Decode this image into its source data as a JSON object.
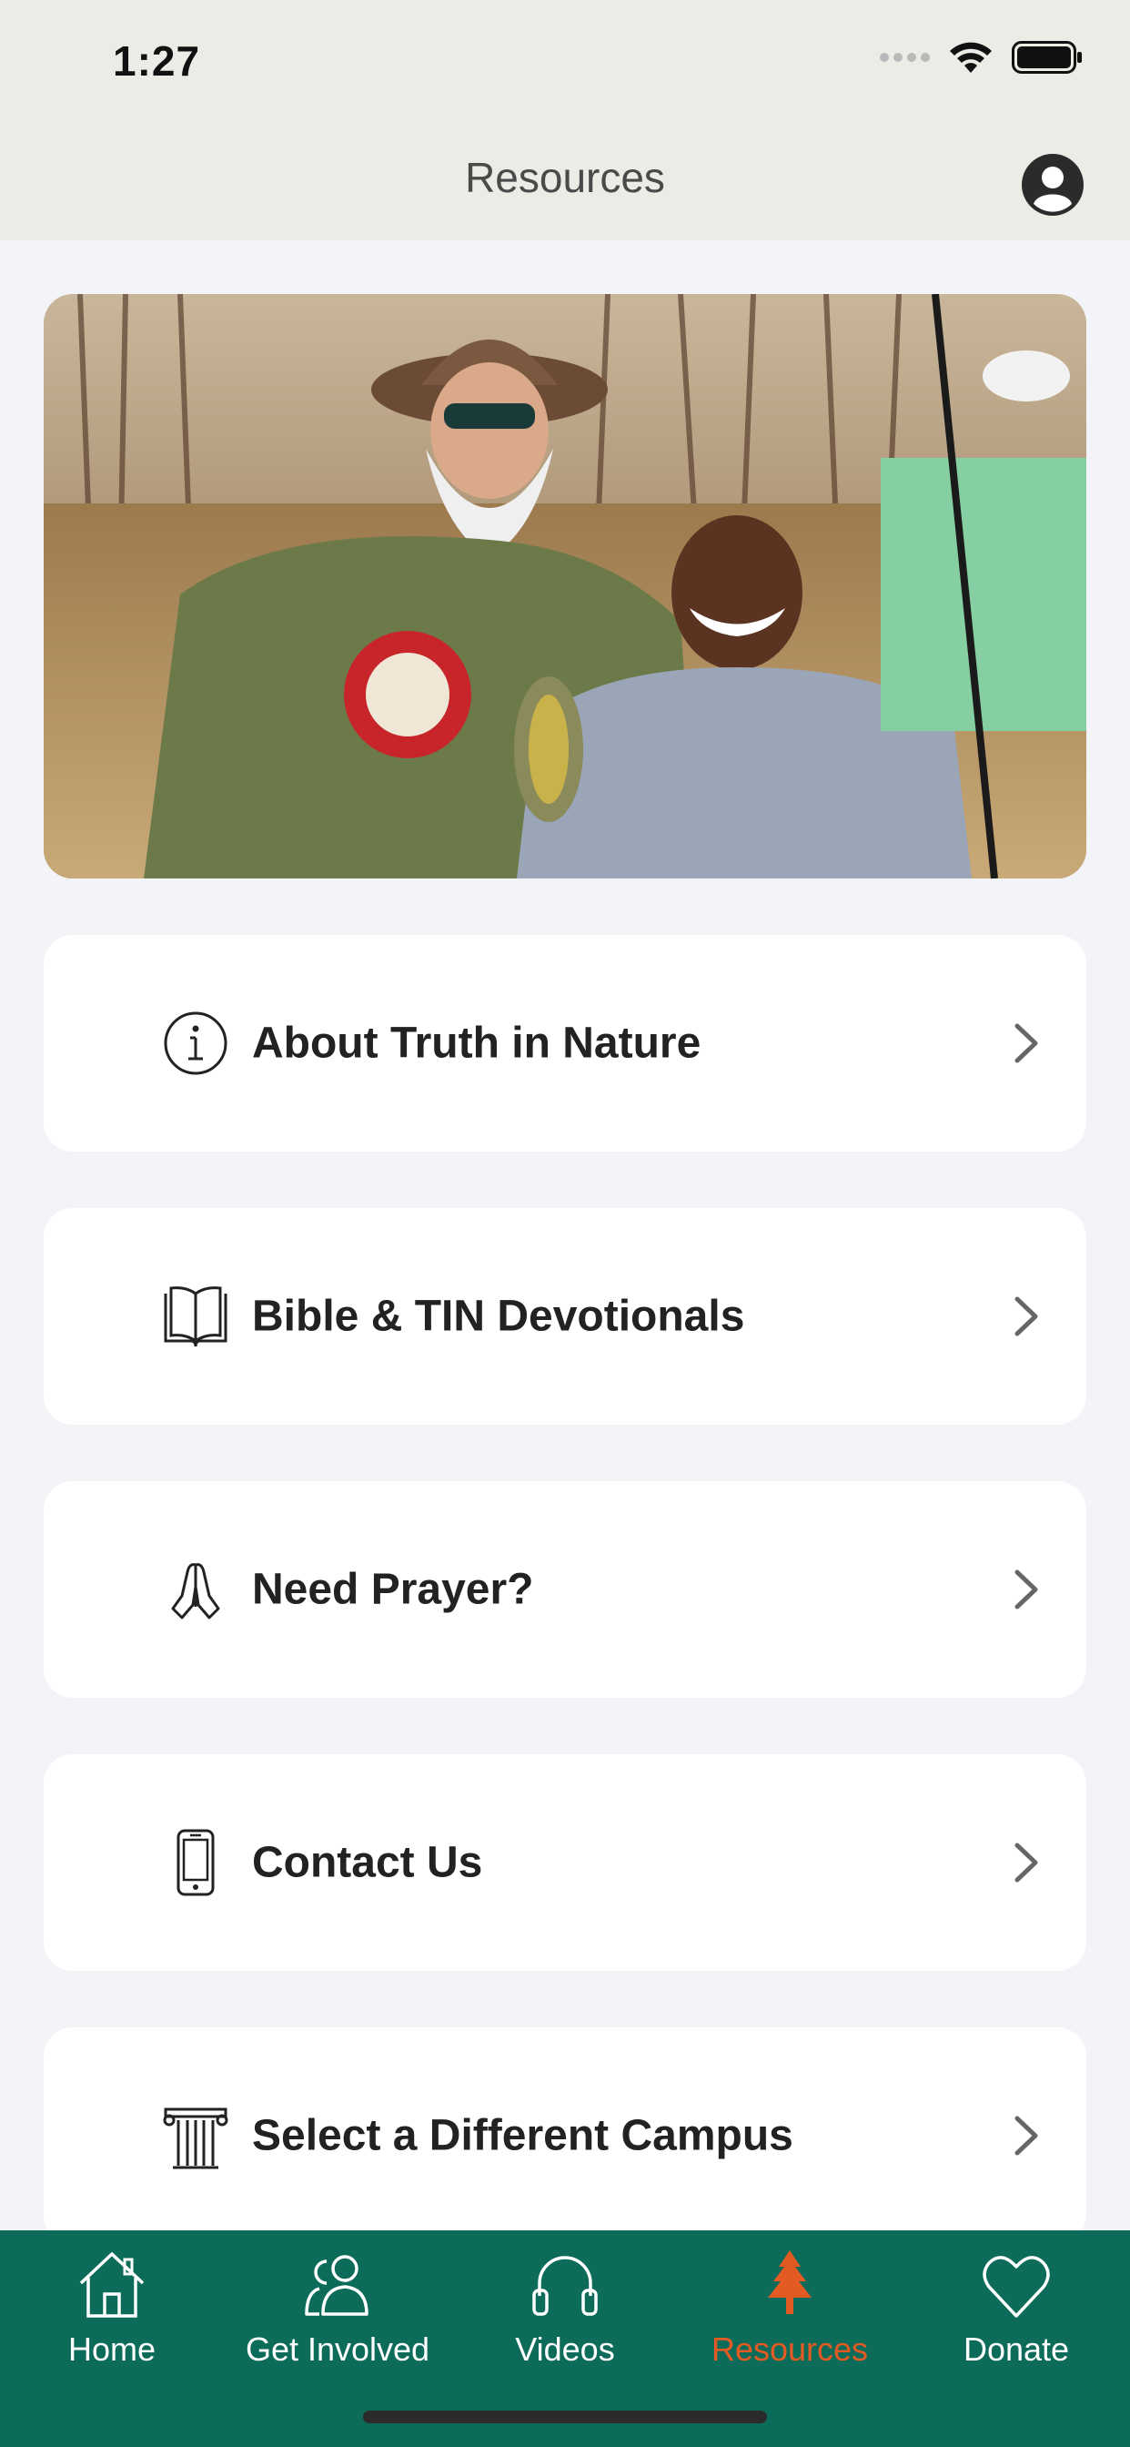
{
  "status_bar": {
    "time": "1:27"
  },
  "header": {
    "title": "Resources"
  },
  "menu": [
    {
      "label": "About Truth in Nature",
      "icon": "info-icon"
    },
    {
      "label": "Bible & TIN Devotionals",
      "icon": "book-icon"
    },
    {
      "label": "Need Prayer?",
      "icon": "praying-hands-icon"
    },
    {
      "label": "Contact Us",
      "icon": "phone-icon"
    },
    {
      "label": "Select a Different Campus",
      "icon": "pillar-icon"
    }
  ],
  "tabs": [
    {
      "label": "Home",
      "icon": "house-icon"
    },
    {
      "label": "Get Involved",
      "icon": "people-icon"
    },
    {
      "label": "Videos",
      "icon": "headphones-icon"
    },
    {
      "label": "Resources",
      "icon": "tree-icon",
      "active": true
    },
    {
      "label": "Donate",
      "icon": "heart-icon"
    }
  ],
  "colors": {
    "header_bg": "#edebe6",
    "page_bg": "#f3f4f8",
    "tabbar_bg": "#0d6b59",
    "active_tab": "#e35a22"
  }
}
